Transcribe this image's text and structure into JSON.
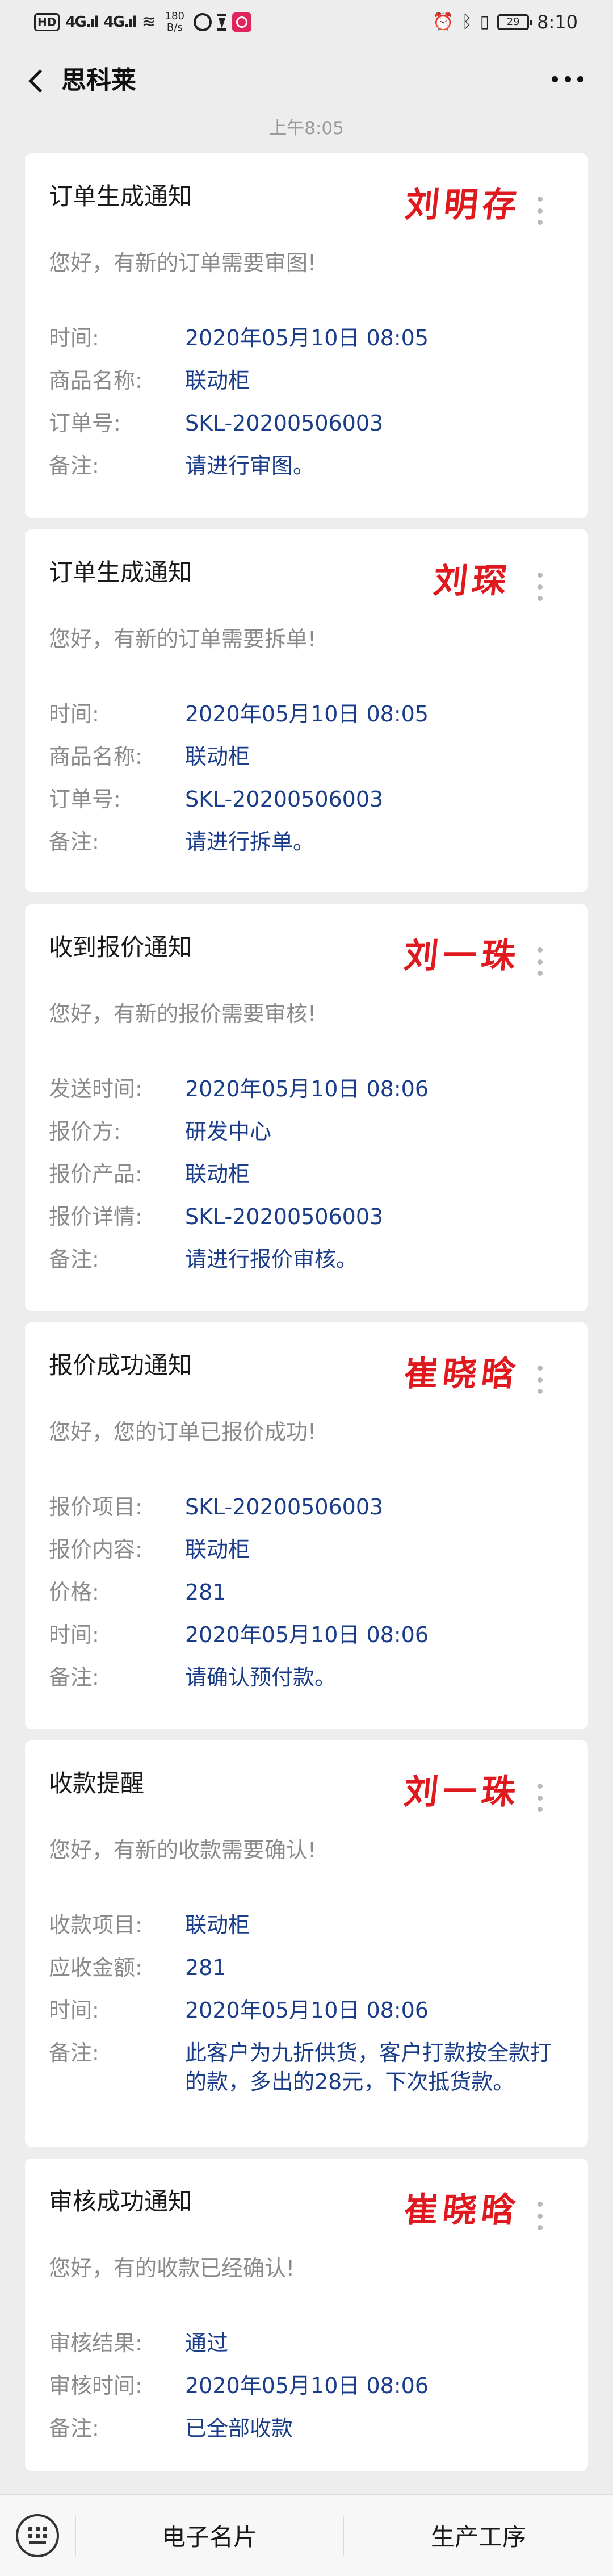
{
  "statusbar": {
    "hd": "HD",
    "sig1": "4G.ıl",
    "sig2": "4G.ıl",
    "speed_value": "180",
    "speed_unit": "B/s",
    "battery": "29",
    "time": "8:10"
  },
  "navbar": {
    "title": "思科莱"
  },
  "chat": {
    "timestamp": "上午8:05"
  },
  "cards": [
    {
      "title": "订单生成通知",
      "signature": "刘明存",
      "intro": "您好，有新的订单需要审图!",
      "rows": [
        {
          "label": "时间:",
          "value": "2020年05月10日 08:05"
        },
        {
          "label": "商品名称:",
          "value": "联动柜"
        },
        {
          "label": "订单号:",
          "value": "SKL-20200506003"
        },
        {
          "label": "备注:",
          "value": "请进行审图。"
        }
      ]
    },
    {
      "title": "订单生成通知",
      "signature": "刘琛",
      "intro": "您好，有新的订单需要拆单!",
      "rows": [
        {
          "label": "时间:",
          "value": "2020年05月10日 08:05"
        },
        {
          "label": "商品名称:",
          "value": "联动柜"
        },
        {
          "label": "订单号:",
          "value": "SKL-20200506003"
        },
        {
          "label": "备注:",
          "value": "请进行拆单。"
        }
      ]
    },
    {
      "title": "收到报价通知",
      "signature": "刘一珠",
      "intro": "您好，有新的报价需要审核!",
      "rows": [
        {
          "label": "发送时间:",
          "value": "2020年05月10日 08:06"
        },
        {
          "label": "报价方:",
          "value": "研发中心"
        },
        {
          "label": "报价产品:",
          "value": "联动柜"
        },
        {
          "label": "报价详情:",
          "value": "SKL-20200506003"
        },
        {
          "label": "备注:",
          "value": "请进行报价审核。"
        }
      ]
    },
    {
      "title": "报价成功通知",
      "signature": "崔晓晗",
      "intro": "您好，您的订单已报价成功!",
      "rows": [
        {
          "label": "报价项目:",
          "value": "SKL-20200506003"
        },
        {
          "label": "报价内容:",
          "value": "联动柜"
        },
        {
          "label": "价格:",
          "value": "281"
        },
        {
          "label": "时间:",
          "value": "2020年05月10日 08:06"
        },
        {
          "label": "备注:",
          "value": "请确认预付款。"
        }
      ]
    },
    {
      "title": "收款提醒",
      "signature": "刘一珠",
      "intro": "您好，有新的收款需要确认!",
      "rows": [
        {
          "label": "收款项目:",
          "value": "联动柜"
        },
        {
          "label": "应收金额:",
          "value": "281"
        },
        {
          "label": "时间:",
          "value": "2020年05月10日 08:06"
        },
        {
          "label": "备注:",
          "value": "此客户为九折供货，客户打款按全款打的款，多出的28元，下次抵货款。"
        }
      ]
    },
    {
      "title": "审核成功通知",
      "signature": "崔晓晗",
      "intro": "您好，有的收款已经确认!",
      "rows": [
        {
          "label": "审核结果:",
          "value": "通过"
        },
        {
          "label": "审核时间:",
          "value": "2020年05月10日 08:06"
        },
        {
          "label": "备注:",
          "value": "已全部收款"
        }
      ]
    }
  ],
  "bottom_menu": {
    "keyboard_icon": "keyboard-icon",
    "item1": "电子名片",
    "item2": "生产工序"
  },
  "colors": {
    "background": "#ededed",
    "value_text": "#1a3d8a",
    "signature": "#e0191e"
  }
}
